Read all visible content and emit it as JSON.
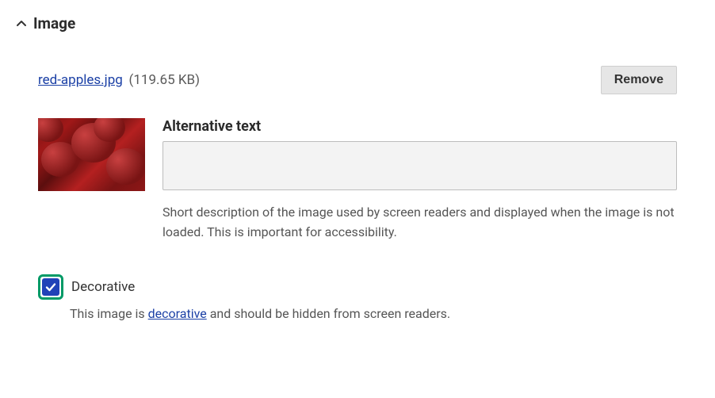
{
  "section": {
    "title": "Image"
  },
  "file": {
    "name": "red-apples.jpg",
    "size": "(119.65 KB)"
  },
  "buttons": {
    "remove": "Remove"
  },
  "alt": {
    "label": "Alternative text",
    "value": "",
    "help": "Short description of the image used by screen readers and displayed when the image is not loaded. This is important for accessibility."
  },
  "decorative": {
    "label": "Decorative",
    "checked": true,
    "help_prefix": "This image is ",
    "help_link": "decorative",
    "help_suffix": " and should be hidden from screen readers."
  }
}
